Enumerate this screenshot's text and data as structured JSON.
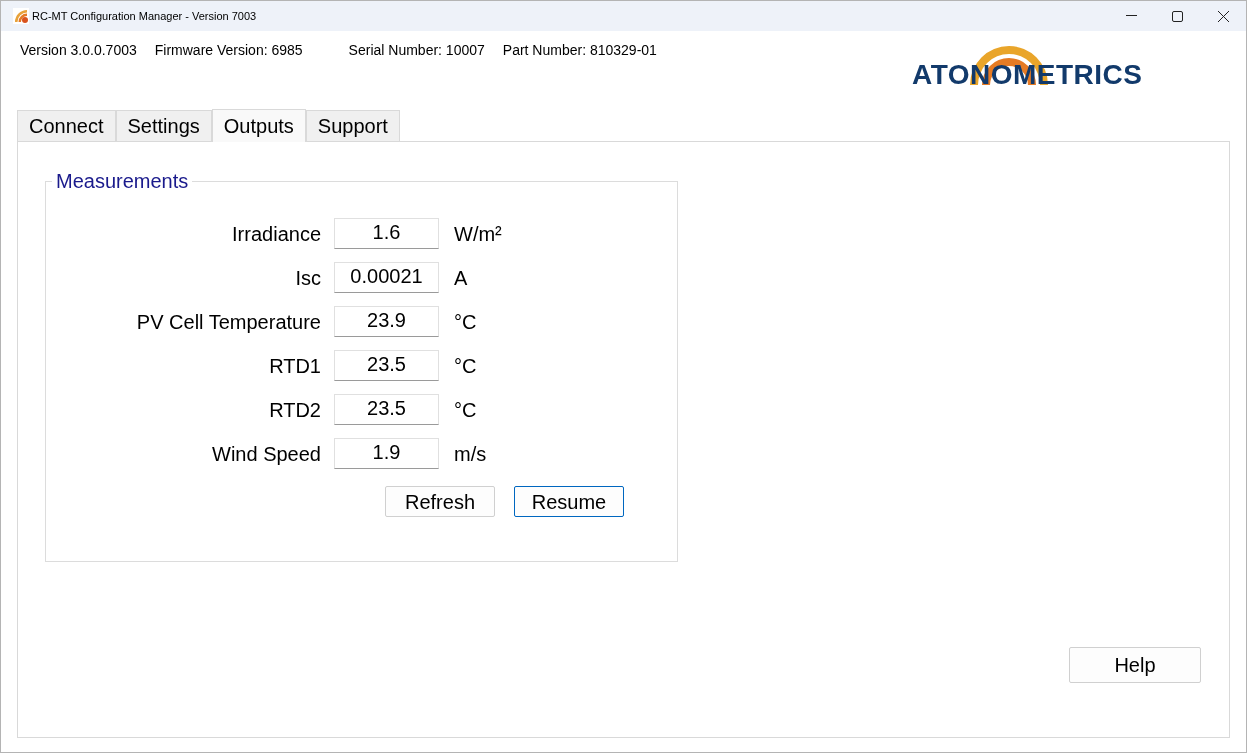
{
  "window": {
    "title": "RC-MT Configuration Manager - Version 7003"
  },
  "info": [
    "Version 3.0.0.7003",
    "Firmware Version: 6985",
    "Serial Number: 10007",
    "Part Number: 810329-01"
  ],
  "logo": {
    "text": "ATONOMETRICS"
  },
  "tabs": [
    {
      "label": "Connect",
      "selected": false
    },
    {
      "label": "Settings",
      "selected": false
    },
    {
      "label": "Outputs",
      "selected": true
    },
    {
      "label": "Support",
      "selected": false
    }
  ],
  "group": {
    "title": "Measurements",
    "rows": [
      {
        "label": "Irradiance",
        "value": "1.6",
        "unit": "W/m²"
      },
      {
        "label": "Isc",
        "value": "0.00021",
        "unit": "A"
      },
      {
        "label": "PV Cell Temperature",
        "value": "23.9",
        "unit": "°C"
      },
      {
        "label": "RTD1",
        "value": "23.5",
        "unit": "°C"
      },
      {
        "label": "RTD2",
        "value": "23.5",
        "unit": "°C"
      },
      {
        "label": "Wind Speed",
        "value": "1.9",
        "unit": "m/s"
      }
    ],
    "buttons": [
      {
        "label": "Refresh",
        "focused": false
      },
      {
        "label": "Resume",
        "focused": true
      }
    ]
  },
  "help_button": {
    "label": "Help"
  }
}
